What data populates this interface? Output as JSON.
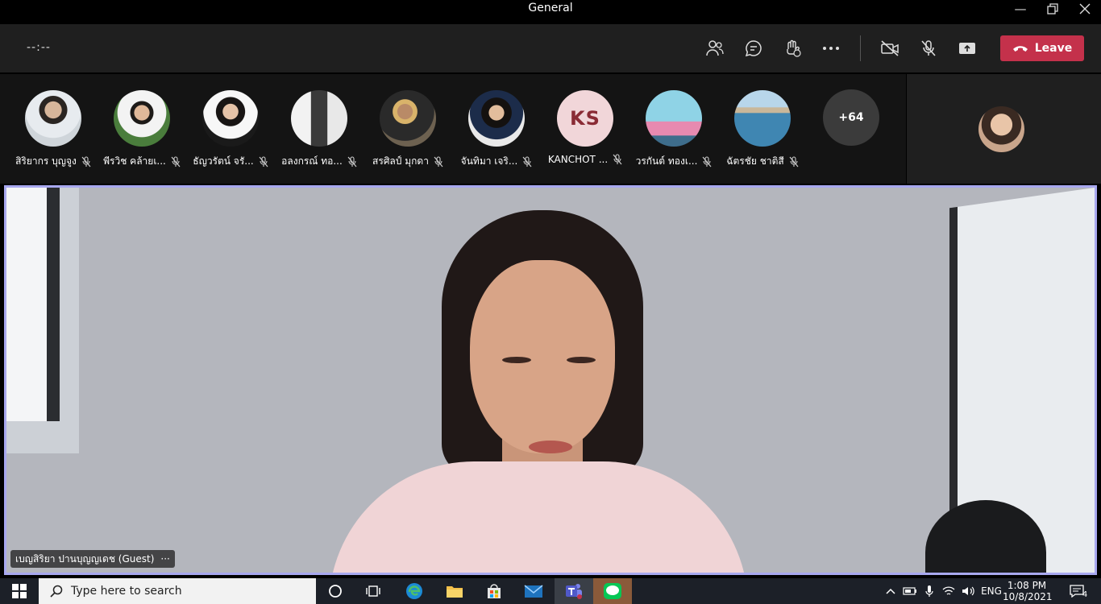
{
  "window": {
    "title": "General"
  },
  "toolbar": {
    "timer": "--:--",
    "leave_label": "Leave"
  },
  "participants": [
    {
      "name": "สิริยากร บุญจูง"
    },
    {
      "name": "พีรวิช คล้ายเ..."
    },
    {
      "name": "ธัญวรัตน์ จรั..."
    },
    {
      "name": "อลงกรณ์ ทอ..."
    },
    {
      "name": "สรศิลป์ มุกดา"
    },
    {
      "name": "จันทิมา เจริ..."
    },
    {
      "name": "KANCHOT ...",
      "initials": "KS"
    },
    {
      "name": "วรกันต์ ทองเ..."
    },
    {
      "name": "ฉัตรชัย ชาติสี"
    }
  ],
  "overflow": {
    "label": "+64"
  },
  "stage": {
    "speaker_label": "เบญสิริยา ปานบุญญเดช (Guest)",
    "more": "···"
  },
  "taskbar": {
    "search_placeholder": "Type here to search",
    "language": "ENG",
    "time": "1:08 PM",
    "date": "10/8/2021",
    "notifications": "4"
  },
  "colors": {
    "leave": "#c4314b",
    "stage_border": "#a8a8ef",
    "toolbar": "#1f1f1f"
  }
}
